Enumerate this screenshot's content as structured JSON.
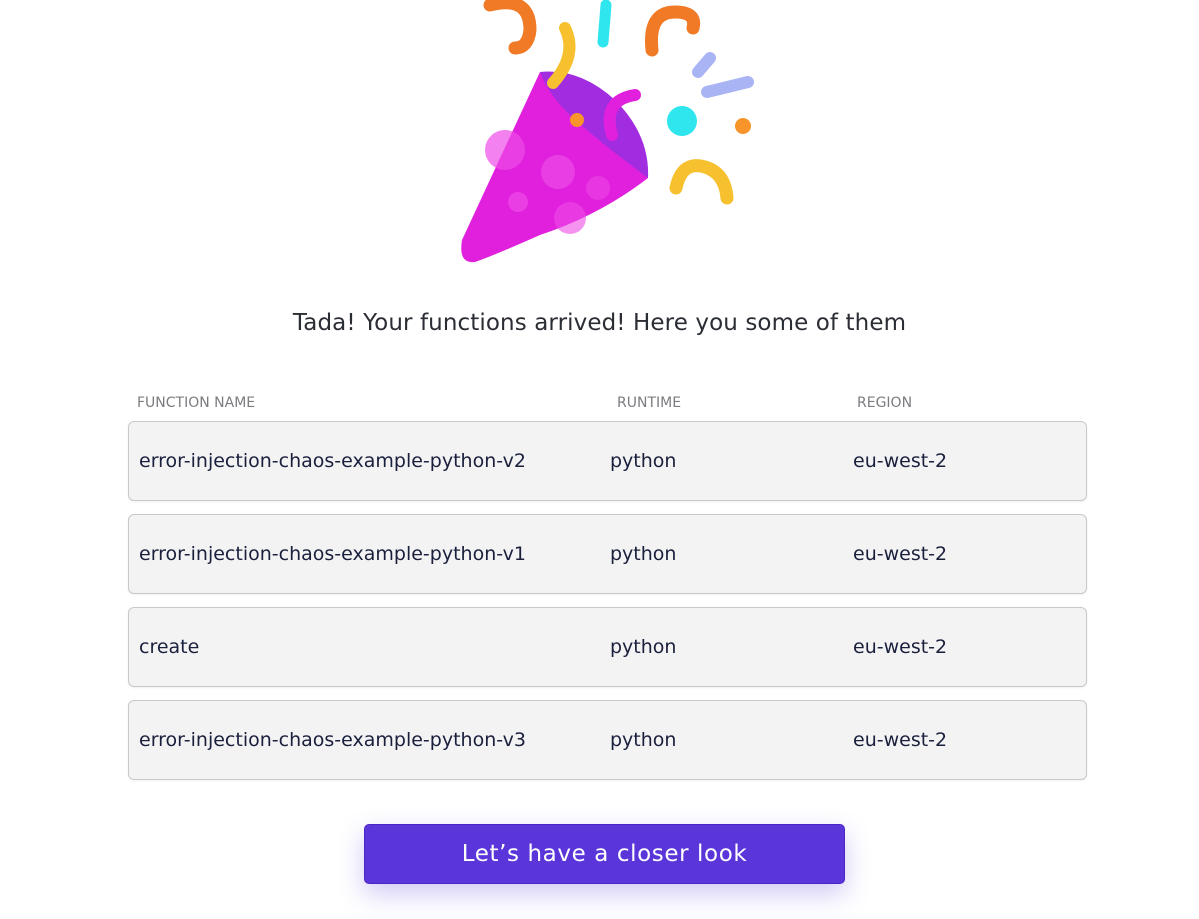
{
  "headline": "Tada! Your functions arrived! Here you some of them",
  "table": {
    "columns": {
      "name": "FUNCTION NAME",
      "runtime": "RUNTIME",
      "region": "REGION"
    },
    "rows": [
      {
        "name": "error-injection-chaos-example-python-v2",
        "runtime": "python",
        "region": "eu-west-2"
      },
      {
        "name": "error-injection-chaos-example-python-v1",
        "runtime": "python",
        "region": "eu-west-2"
      },
      {
        "name": "create",
        "runtime": "python",
        "region": "eu-west-2"
      },
      {
        "name": "error-injection-chaos-example-python-v3",
        "runtime": "python",
        "region": "eu-west-2"
      }
    ]
  },
  "cta": {
    "label": "Let’s have a closer look"
  },
  "illustration": {
    "icon": "party-popper-icon",
    "colors": {
      "cone": "#e020dc",
      "cone_shadow": "#a22de0",
      "orange": "#f07a26",
      "yellow": "#f7c02e",
      "cyan": "#2fe6ef",
      "lavender": "#a9b4f5",
      "button": "#5a35d9"
    }
  }
}
